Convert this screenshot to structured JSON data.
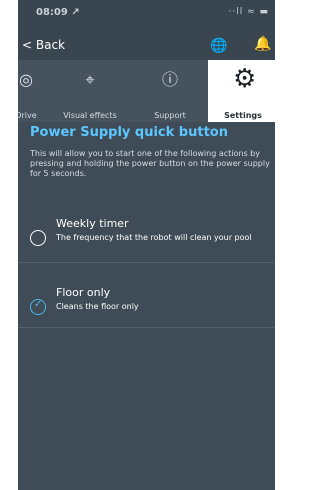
{
  "status_bar": {
    "time": "08:09 ↗",
    "indicators": "··ll ≈ ▬"
  },
  "nav": {
    "back_label": "< Back",
    "globe_icon": "globe-icon",
    "bell_icon": "bell-icon"
  },
  "tabs": [
    {
      "label": "Drive",
      "icon": "drive-icon",
      "active": false
    },
    {
      "label": "Visual effects",
      "icon": "visual-effects-icon",
      "active": false
    },
    {
      "label": "Support",
      "icon": "info-icon",
      "active": false
    },
    {
      "label": "Settings",
      "icon": "gear-icon",
      "active": true
    }
  ],
  "content": {
    "title": "Power Supply quick button",
    "description": "This will allow you to start one of the following actions by pressing and holding the power button on the power supply for 5 seconds.",
    "options": [
      {
        "title": "Weekly timer",
        "subtitle": "The frequency that the robot will clean your pool",
        "selected": false
      },
      {
        "title": "Floor only",
        "subtitle": "Cleans the floor only",
        "selected": true
      }
    ]
  },
  "colors": {
    "accent": "#5cc7ff",
    "background": "#3f4b57",
    "active_tab": "#ffffff"
  }
}
